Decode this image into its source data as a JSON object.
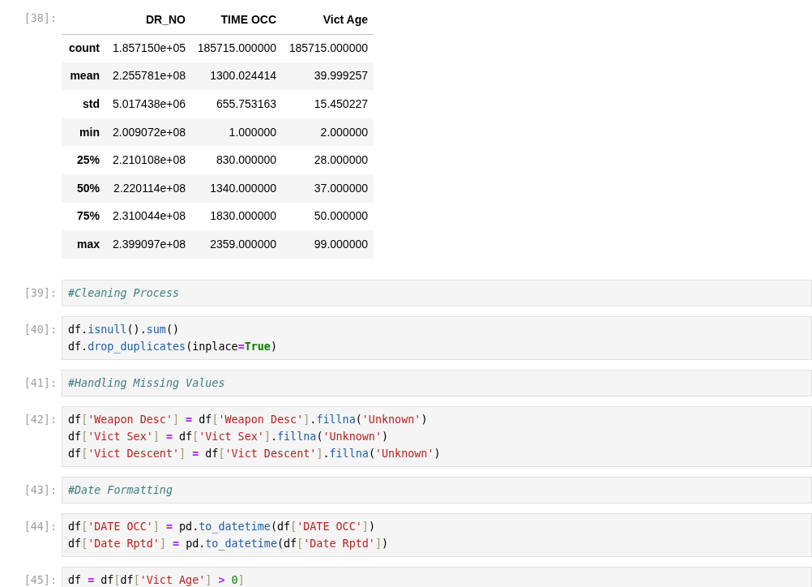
{
  "describe_output": {
    "prompt": "[38]:",
    "columns": [
      "DR_NO",
      "TIME OCC",
      "Vict Age"
    ],
    "rows": [
      {
        "label": "count",
        "values": [
          "1.857150e+05",
          "185715.000000",
          "185715.000000"
        ]
      },
      {
        "label": "mean",
        "values": [
          "2.255781e+08",
          "1300.024414",
          "39.999257"
        ]
      },
      {
        "label": "std",
        "values": [
          "5.017438e+06",
          "655.753163",
          "15.450227"
        ]
      },
      {
        "label": "min",
        "values": [
          "2.009072e+08",
          "1.000000",
          "2.000000"
        ]
      },
      {
        "label": "25%",
        "values": [
          "2.210108e+08",
          "830.000000",
          "28.000000"
        ]
      },
      {
        "label": "50%",
        "values": [
          "2.220114e+08",
          "1340.000000",
          "37.000000"
        ]
      },
      {
        "label": "75%",
        "values": [
          "2.310044e+08",
          "1830.000000",
          "50.000000"
        ]
      },
      {
        "label": "max",
        "values": [
          "2.399097e+08",
          "2359.000000",
          "99.000000"
        ]
      }
    ]
  },
  "cells": [
    {
      "prompt": "[39]:",
      "lines": [
        [
          {
            "kind": "comment",
            "text": "#Cleaning Process"
          }
        ]
      ]
    },
    {
      "prompt": "[40]:",
      "lines": [
        [
          {
            "kind": "name",
            "text": "df."
          },
          {
            "kind": "func",
            "text": "isnull"
          },
          {
            "kind": "name",
            "text": "()."
          },
          {
            "kind": "func",
            "text": "sum"
          },
          {
            "kind": "name",
            "text": "()"
          }
        ],
        [
          {
            "kind": "name",
            "text": "df."
          },
          {
            "kind": "func",
            "text": "drop_duplicates"
          },
          {
            "kind": "name",
            "text": "(inplace"
          },
          {
            "kind": "op",
            "text": "="
          },
          {
            "kind": "keyword",
            "text": "True"
          },
          {
            "kind": "name",
            "text": ")"
          }
        ]
      ]
    },
    {
      "prompt": "[41]:",
      "lines": [
        [
          {
            "kind": "comment",
            "text": "#Handling Missing Values"
          }
        ]
      ]
    },
    {
      "prompt": "[42]:",
      "lines": [
        [
          {
            "kind": "name",
            "text": "df"
          },
          {
            "kind": "bracket",
            "text": "["
          },
          {
            "kind": "string",
            "text": "'Weapon Desc'"
          },
          {
            "kind": "bracket",
            "text": "]"
          },
          {
            "kind": "op",
            "text": " = "
          },
          {
            "kind": "name",
            "text": "df"
          },
          {
            "kind": "bracket",
            "text": "["
          },
          {
            "kind": "string",
            "text": "'Weapon Desc'"
          },
          {
            "kind": "bracket",
            "text": "]"
          },
          {
            "kind": "name",
            "text": "."
          },
          {
            "kind": "func",
            "text": "fillna"
          },
          {
            "kind": "name",
            "text": "("
          },
          {
            "kind": "string",
            "text": "'Unknown'"
          },
          {
            "kind": "name",
            "text": ")"
          }
        ],
        [
          {
            "kind": "name",
            "text": "df"
          },
          {
            "kind": "bracket",
            "text": "["
          },
          {
            "kind": "string",
            "text": "'Vict Sex'"
          },
          {
            "kind": "bracket",
            "text": "]"
          },
          {
            "kind": "op",
            "text": " = "
          },
          {
            "kind": "name",
            "text": "df"
          },
          {
            "kind": "bracket",
            "text": "["
          },
          {
            "kind": "string",
            "text": "'Vict Sex'"
          },
          {
            "kind": "bracket",
            "text": "]"
          },
          {
            "kind": "name",
            "text": "."
          },
          {
            "kind": "func",
            "text": "fillna"
          },
          {
            "kind": "name",
            "text": "("
          },
          {
            "kind": "string",
            "text": "'Unknown'"
          },
          {
            "kind": "name",
            "text": ")"
          }
        ],
        [
          {
            "kind": "name",
            "text": "df"
          },
          {
            "kind": "bracket",
            "text": "["
          },
          {
            "kind": "string",
            "text": "'Vict Descent'"
          },
          {
            "kind": "bracket",
            "text": "]"
          },
          {
            "kind": "op",
            "text": " = "
          },
          {
            "kind": "name",
            "text": "df"
          },
          {
            "kind": "bracket",
            "text": "["
          },
          {
            "kind": "string",
            "text": "'Vict Descent'"
          },
          {
            "kind": "bracket",
            "text": "]"
          },
          {
            "kind": "name",
            "text": "."
          },
          {
            "kind": "func",
            "text": "fillna"
          },
          {
            "kind": "name",
            "text": "("
          },
          {
            "kind": "string",
            "text": "'Unknown'"
          },
          {
            "kind": "name",
            "text": ")"
          }
        ]
      ]
    },
    {
      "prompt": "[43]:",
      "lines": [
        [
          {
            "kind": "comment",
            "text": "#Date Formatting"
          }
        ]
      ]
    },
    {
      "prompt": "[44]:",
      "lines": [
        [
          {
            "kind": "name",
            "text": "df"
          },
          {
            "kind": "bracket",
            "text": "["
          },
          {
            "kind": "string",
            "text": "'DATE OCC'"
          },
          {
            "kind": "bracket",
            "text": "]"
          },
          {
            "kind": "op",
            "text": " = "
          },
          {
            "kind": "name",
            "text": "pd."
          },
          {
            "kind": "func",
            "text": "to_datetime"
          },
          {
            "kind": "name",
            "text": "(df"
          },
          {
            "kind": "bracket",
            "text": "["
          },
          {
            "kind": "string",
            "text": "'DATE OCC'"
          },
          {
            "kind": "bracket",
            "text": "]"
          },
          {
            "kind": "name",
            "text": ")"
          }
        ],
        [
          {
            "kind": "name",
            "text": "df"
          },
          {
            "kind": "bracket",
            "text": "["
          },
          {
            "kind": "string",
            "text": "'Date Rptd'"
          },
          {
            "kind": "bracket",
            "text": "]"
          },
          {
            "kind": "op",
            "text": " = "
          },
          {
            "kind": "name",
            "text": "pd."
          },
          {
            "kind": "func",
            "text": "to_datetime"
          },
          {
            "kind": "name",
            "text": "(df"
          },
          {
            "kind": "bracket",
            "text": "["
          },
          {
            "kind": "string",
            "text": "'Date Rptd'"
          },
          {
            "kind": "bracket",
            "text": "]"
          },
          {
            "kind": "name",
            "text": ")"
          }
        ]
      ]
    },
    {
      "prompt": "[45]:",
      "lines": [
        [
          {
            "kind": "name",
            "text": "df"
          },
          {
            "kind": "op",
            "text": " = "
          },
          {
            "kind": "name",
            "text": "df"
          },
          {
            "kind": "bracket",
            "text": "["
          },
          {
            "kind": "name",
            "text": "df"
          },
          {
            "kind": "bracket",
            "text": "["
          },
          {
            "kind": "string",
            "text": "'Vict Age'"
          },
          {
            "kind": "bracket",
            "text": "]"
          },
          {
            "kind": "op",
            "text": " > "
          },
          {
            "kind": "number",
            "text": "0"
          },
          {
            "kind": "bracket",
            "text": "]"
          }
        ]
      ]
    }
  ]
}
